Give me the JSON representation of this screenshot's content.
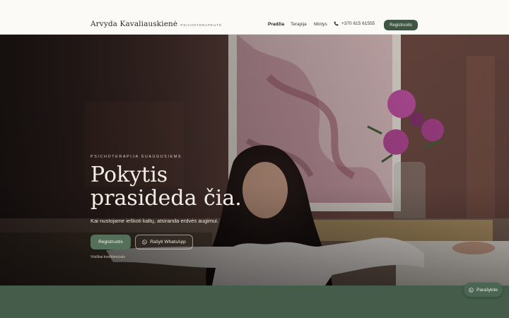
{
  "header": {
    "brand_name": "Arvyda Kavaliauskienė",
    "brand_tag": "PSICHOTERAPEUTĖ",
    "nav": [
      {
        "label": "Pradžia",
        "active": true
      },
      {
        "label": "Terapija",
        "active": false
      },
      {
        "label": "Mintys",
        "active": false
      }
    ],
    "phone": "+370 615 61555",
    "phone_icon": "phone-icon",
    "register_label": "Registruotis"
  },
  "hero": {
    "eyebrow": "PSICHOTERAPIJA SUAUGUSIEMS",
    "headline_line1": "Pokytis",
    "headline_line2": "prasideda čia.",
    "subline": "Kai nustojame ieškoti kaltų, atsiranda erdvės augimui.",
    "cta_primary": "Registruotis",
    "cta_secondary": "Rašyti WhatsApp",
    "cta_secondary_icon": "whatsapp-icon",
    "privacy_text": "Visiškai konfidencialu"
  },
  "chat": {
    "label": "Parašykite",
    "icon": "whatsapp-icon"
  },
  "colors": {
    "accent_green": "#3f5644",
    "band_green": "#445c49",
    "header_bg": "#fbfaf7"
  }
}
